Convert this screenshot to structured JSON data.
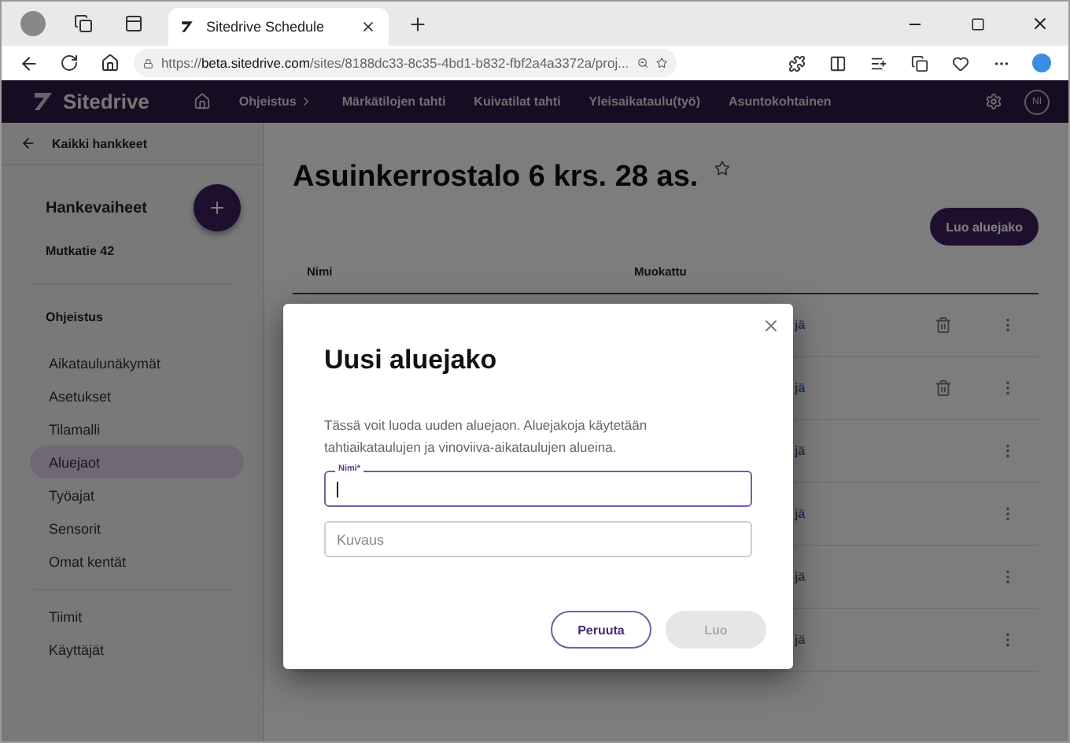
{
  "browser": {
    "tab_title": "Sitedrive Schedule",
    "url_prefix": "https://",
    "url_host": "beta.sitedrive.com",
    "url_path": "/sites/8188dc33-8c35-4bd1-b832-fbf2a4a3372a/proj..."
  },
  "app_nav": {
    "logo": "Sitedrive",
    "items": [
      {
        "label": "Ohjeistus",
        "kind": "menu"
      },
      {
        "label": "Märkätilojen tahti",
        "kind": "link"
      },
      {
        "label": "Kuivatilat tahti",
        "kind": "link"
      },
      {
        "label": "Yleisaikataulu(työ)",
        "kind": "link"
      },
      {
        "label": "Asuntokohtainen",
        "kind": "link"
      }
    ],
    "avatar": "NI"
  },
  "sidebar": {
    "back_link": "Kaikki hankkeet",
    "heading": "Hankevaiheet",
    "project": "Mutkatie 42",
    "section": "Ohjeistus",
    "items": [
      {
        "label": "Aikataulunäkymät",
        "selected": false
      },
      {
        "label": "Asetukset",
        "selected": false
      },
      {
        "label": "Tilamalli",
        "selected": false
      },
      {
        "label": "Aluejaot",
        "selected": true
      },
      {
        "label": "Työajat",
        "selected": false
      },
      {
        "label": "Sensorit",
        "selected": false
      },
      {
        "label": "Omat kentät",
        "selected": false
      }
    ],
    "bottom_items": [
      {
        "label": "Tiimit",
        "selected": false
      },
      {
        "label": "Käyttäjät",
        "selected": false
      }
    ]
  },
  "page": {
    "title": "Asuinkerrostalo 6 krs. 28 as.",
    "create_button": "Luo aluejako",
    "table": {
      "columns": [
        "Nimi",
        "Muokattu"
      ],
      "rows": [
        {
          "column_2": "jä",
          "deletable": true
        },
        {
          "column_2": "jä",
          "deletable": true
        },
        {
          "column_2": "jä",
          "deletable": false
        },
        {
          "column_2": "jä",
          "deletable": false
        },
        {
          "column_2": "jä",
          "deletable": false
        },
        {
          "column_2": "jä",
          "deletable": false
        }
      ]
    }
  },
  "dialog": {
    "title": "Uusi aluejako",
    "description": "Tässä voit luoda uuden aluejaon. Aluejakoja käytetään tahtiaikataulujen ja vinoviiva-aikataulujen alueina.",
    "name_field": {
      "label": "Nimi*",
      "focused": true
    },
    "description_field": {
      "placeholder": "Kuvaus"
    },
    "buttons": [
      {
        "label": "Peruuta",
        "kind": "outline"
      },
      {
        "label": "Luo",
        "kind": "filled",
        "disabled": true
      }
    ]
  }
}
